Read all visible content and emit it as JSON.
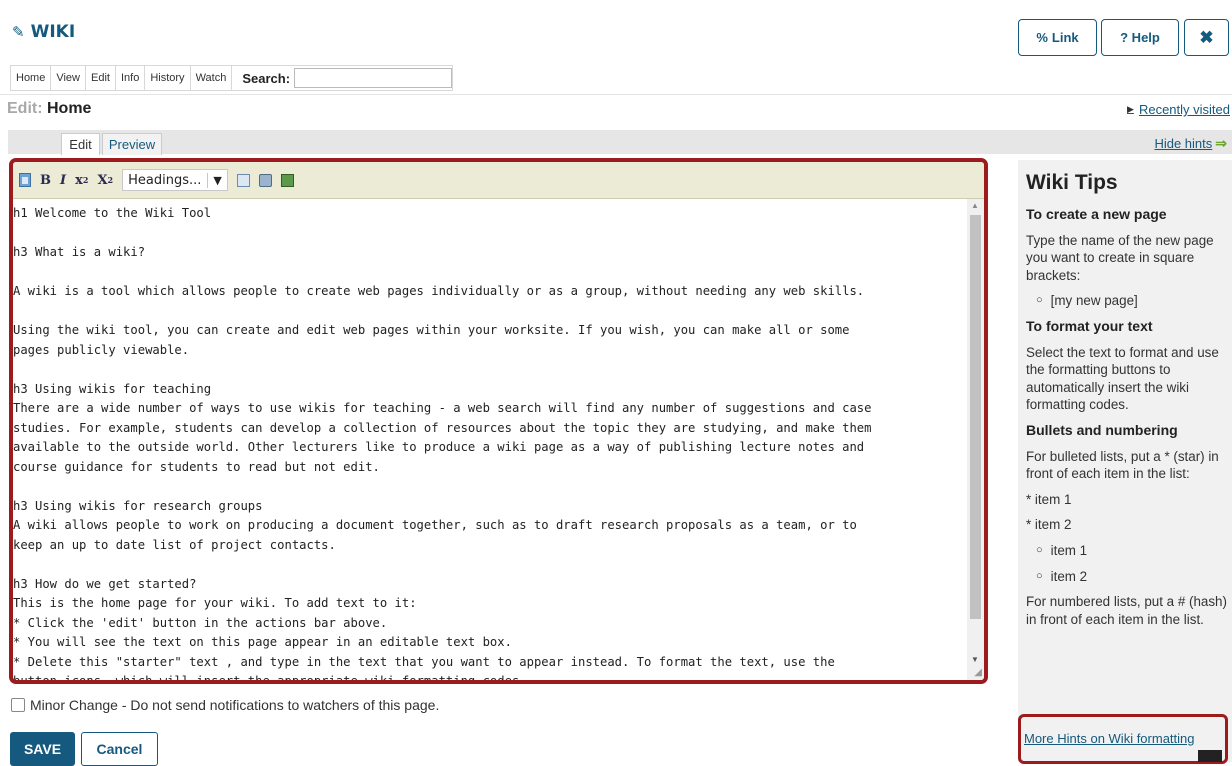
{
  "tool": {
    "title": "WIKI"
  },
  "top_buttons": {
    "link": "Link",
    "help": "? Help"
  },
  "nav": {
    "items": [
      "Home",
      "View",
      "Edit",
      "Info",
      "History",
      "Watch"
    ],
    "search_label": "Search:"
  },
  "heading": {
    "prefix": "Edit:",
    "page": "Home"
  },
  "recently_visited": "Recently visited",
  "tabs": {
    "edit": "Edit",
    "preview": "Preview"
  },
  "hide_hints": "Hide hints",
  "toolbar": {
    "headings_value": "Headings..."
  },
  "editor": {
    "text": "h1 Welcome to the Wiki Tool\n\nh3 What is a wiki?\n\nA wiki is a tool which allows people to create web pages individually or as a group, without needing any web skills.\n\nUsing the wiki tool, you can create and edit web pages within your worksite. If you wish, you can make all or some\npages publicly viewable.\n\nh3 Using wikis for teaching\nThere are a wide number of ways to use wikis for teaching - a web search will find any number of suggestions and case\nstudies. For example, students can develop a collection of resources about the topic they are studying, and make them\navailable to the outside world. Other lecturers like to produce a wiki page as a way of publishing lecture notes and\ncourse guidance for students to read but not edit.\n\nh3 Using wikis for research groups\nA wiki allows people to work on producing a document together, such as to draft research proposals as a team, or to\nkeep an up to date list of project contacts.\n\nh3 How do we get started?\nThis is the home page for your wiki. To add text to it:\n* Click the 'edit' button in the actions bar above.\n* You will see the text on this page appear in an editable text box.\n* Delete this \"starter\" text , and type in the text that you want to appear instead. To format the text, use the\nbutton icons, which will insert the appropriate wiki formatting codes."
  },
  "minor_change": "Minor Change - Do not send notifications to watchers of this page.",
  "actions": {
    "save": "SAVE",
    "cancel": "Cancel"
  },
  "tips": {
    "title": "Wiki Tips",
    "create_heading": "To create a new page",
    "create_text": "Type the name of the new page you want to create in square brackets:",
    "create_example": "[my new page]",
    "format_heading": "To format your text",
    "format_text": "Select the text to format and use the formatting buttons to automatically insert the wiki formatting codes.",
    "bullets_heading": "Bullets and numbering",
    "bullets_text": "For bulleted lists, put a * (star) in front of each item in the list:",
    "bullet_item1": "* item 1",
    "bullet_item2": "* item 2",
    "sub_item1": "item 1",
    "sub_item2": "item 2",
    "numbered_text": "For numbered lists, put a # (hash) in front of each item in the list.",
    "more_hints": "More Hints on Wiki formatting"
  },
  "colors": {
    "brand": "#15597e",
    "highlight": "#9c1b1f",
    "accent_arrow": "#6aa82d"
  }
}
